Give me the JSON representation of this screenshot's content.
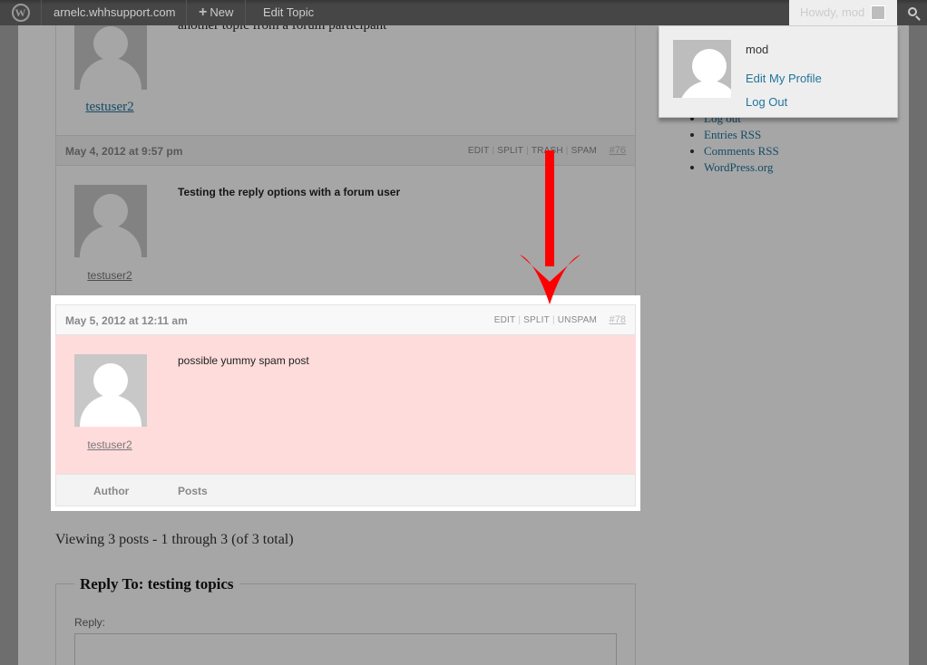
{
  "admin_bar": {
    "site_name": "arnelc.whhsupport.com",
    "new_label": "New",
    "edit_topic_label": "Edit Topic",
    "account_label": "Howdy, mod"
  },
  "account_menu": {
    "username": "mod",
    "edit_profile": "Edit My Profile",
    "log_out": "Log Out"
  },
  "topic": {
    "first_post_text": "another topic from a forum participant",
    "first_post_author": "testuser2"
  },
  "replies": [
    {
      "date": "May 4, 2012 at 9:57 pm",
      "actions": [
        "EDIT",
        "SPLIT",
        "TRASH",
        "SPAM"
      ],
      "permalink": "#76",
      "author": "testuser2",
      "text": "Testing the reply options with a forum user"
    },
    {
      "date": "May 5, 2012 at 12:11 am",
      "actions": [
        "EDIT",
        "SPLIT",
        "UNSPAM"
      ],
      "permalink": "#78",
      "author": "testuser2",
      "text": "possible yummy spam post",
      "status": "spam",
      "highlight_color": "#ffdcdc"
    }
  ],
  "table_footer": {
    "author_col": "Author",
    "posts_col": "Posts"
  },
  "sidebar": {
    "links": [
      "Log out",
      "Entries RSS",
      "Comments RSS",
      "WordPress.org"
    ]
  },
  "pagination_text": "Viewing 3 posts - 1 through 3 (of 3 total)",
  "reply_form": {
    "title": "Reply To: testing topics",
    "reply_label": "Reply:"
  },
  "colors": {
    "admin_bar": "#464646",
    "link": "#21759b",
    "arrow": "#ff0000",
    "spam_background": "#ffdcdc"
  }
}
